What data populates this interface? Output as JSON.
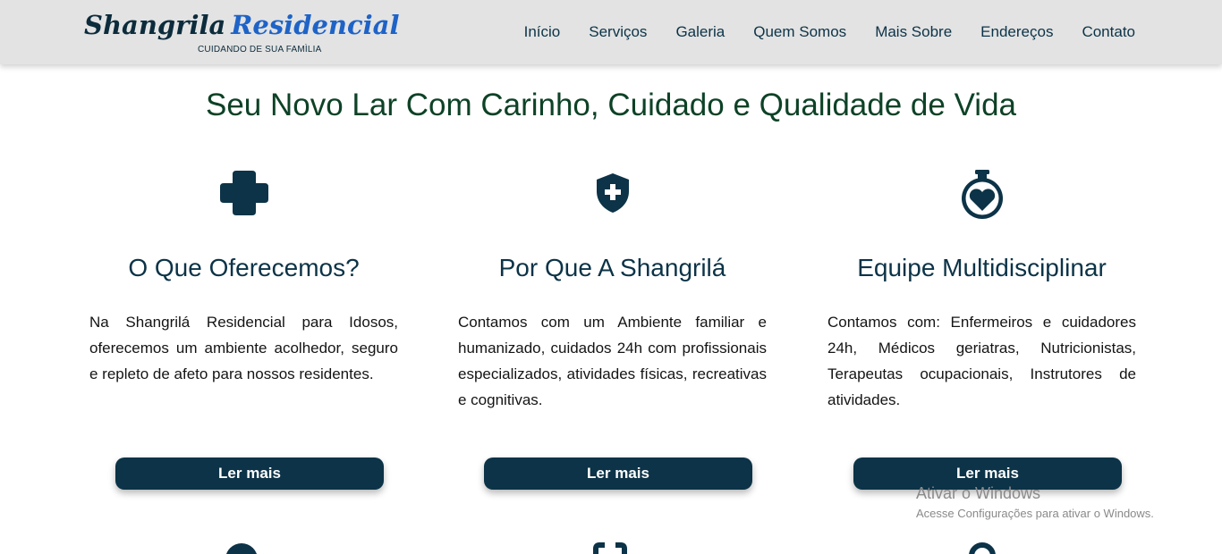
{
  "header": {
    "logo": {
      "name_part1": "Shangrila",
      "name_part2": "Residencial",
      "tagline": "CUIDANDO DE SUA FAMÌLIA"
    },
    "nav": [
      "Início",
      "Serviços",
      "Galeria",
      "Quem Somos",
      "Mais Sobre",
      "Endereços",
      "Contato"
    ]
  },
  "hero": {
    "title": "Seu Novo Lar Com Carinho, Cuidado e Qualidade de Vida"
  },
  "cards": [
    {
      "icon": "medical-cross-icon",
      "title": "O Que Oferecemos?",
      "text": "Na Shangrilá Residencial para Idosos, oferecemos um ambiente acolhedor, seguro e repleto de afeto para nossos residentes.",
      "button": "Ler mais"
    },
    {
      "icon": "shield-plus-icon",
      "title": "Por Que A Shangrilá",
      "text": "Contamos com um Ambiente familiar e humanizado, cuidados 24h com profissionais especializados, atividades físicas, recreativas e cognitivas.",
      "button": "Ler mais"
    },
    {
      "icon": "heart-potion-icon",
      "title": "Equipe Multidisciplinar",
      "text": "Contamos com: Enfermeiros e cuidadores 24h, Médicos geriatras, Nutricionistas, Terapeutas ocupacionais, Instrutores de atividades.",
      "button": "Ler mais"
    }
  ],
  "watermark": {
    "title": "Ativar o Windows",
    "subtitle": "Acesse Configurações para ativar o Windows."
  },
  "colors": {
    "primary": "#0c3347",
    "heading_green": "#0d4226",
    "brand_blue": "#1e63c7",
    "navbar_bg": "#e3e3e3"
  }
}
